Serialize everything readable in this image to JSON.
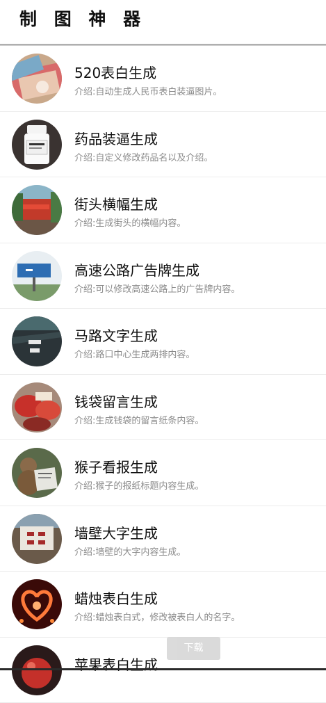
{
  "header": {
    "title": "制 图 神 器"
  },
  "items": [
    {
      "title": "520表白生成",
      "desc": "介绍:自动生成人民币表白装逼图片。",
      "icon": "banknote-thumbnail"
    },
    {
      "title": "药品装逼生成",
      "desc": "介绍:自定义修改药品名以及介绍。",
      "icon": "medicine-bottle-thumbnail"
    },
    {
      "title": "街头横幅生成",
      "desc": "介绍:生成街头的横幅内容。",
      "icon": "street-banner-thumbnail"
    },
    {
      "title": "高速公路广告牌生成",
      "desc": "介绍:可以修改高速公路上的广告牌内容。",
      "icon": "billboard-thumbnail"
    },
    {
      "title": "马路文字生成",
      "desc": "介绍:路口中心生成两排内容。",
      "icon": "road-text-thumbnail"
    },
    {
      "title": "钱袋留言生成",
      "desc": "介绍:生成钱袋的留言纸条内容。",
      "icon": "money-bag-thumbnail"
    },
    {
      "title": "猴子看报生成",
      "desc": "介绍:猴子的报纸标题内容生成。",
      "icon": "monkey-newspaper-thumbnail"
    },
    {
      "title": "墙壁大字生成",
      "desc": "介绍:墙壁的大字内容生成。",
      "icon": "wall-text-thumbnail"
    },
    {
      "title": "蜡烛表白生成",
      "desc": "介绍:蜡烛表白式，修改被表白人的名字。",
      "icon": "candle-heart-thumbnail"
    },
    {
      "title": "苹果表白生成",
      "desc": "",
      "icon": "apple-thumbnail"
    }
  ],
  "download_button": {
    "label": "下载"
  }
}
